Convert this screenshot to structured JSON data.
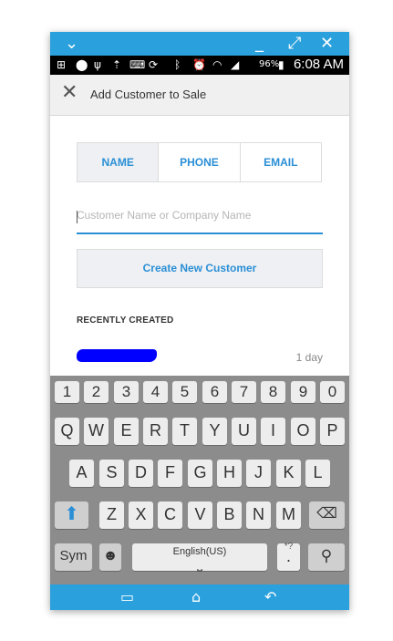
{
  "window": {
    "chevron_icon": "chevron-down-icon",
    "minimize_icon": "minimize-icon",
    "maximize_icon": "maximize-icon",
    "close_icon": "close-icon"
  },
  "statusbar": {
    "battery": "96%",
    "time": "6:08 AM"
  },
  "appbar": {
    "title": "Add Customer to Sale"
  },
  "tabs": [
    {
      "label": "NAME",
      "active": true
    },
    {
      "label": "PHONE",
      "active": false
    },
    {
      "label": "EMAIL",
      "active": false
    }
  ],
  "search": {
    "placeholder": "Customer Name or Company Name"
  },
  "create_button": "Create New Customer",
  "recent": {
    "heading": "RECENTLY CREATED",
    "items": [
      {
        "age": "1 day"
      }
    ]
  },
  "keyboard": {
    "row1": [
      "1",
      "2",
      "3",
      "4",
      "5",
      "6",
      "7",
      "8",
      "9",
      "0"
    ],
    "row2": [
      "Q",
      "W",
      "E",
      "R",
      "T",
      "Y",
      "U",
      "I",
      "O",
      "P"
    ],
    "row3": [
      "A",
      "S",
      "D",
      "F",
      "G",
      "H",
      "J",
      "K",
      "L"
    ],
    "row4": [
      "Z",
      "X",
      "C",
      "V",
      "B",
      "N",
      "M"
    ],
    "sym": "Sym",
    "space_label": "English(US)",
    "period": ".",
    "period_sub": "*?"
  }
}
